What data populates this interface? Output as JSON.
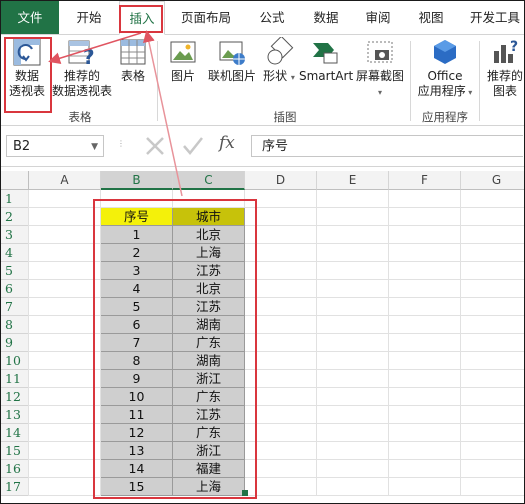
{
  "tabs": [
    "文件",
    "开始",
    "插入",
    "页面布局",
    "公式",
    "数据",
    "审阅",
    "视图",
    "开发工具"
  ],
  "ribbon": {
    "pivot_table": [
      "数据",
      "透视表"
    ],
    "recommended_pivot": [
      "推荐的",
      "数据透视表"
    ],
    "table": "表格",
    "picture": "图片",
    "online_picture": "联机图片",
    "shapes": "形状",
    "smartart": "SmartArt",
    "screenshot": "屏幕截图",
    "office_apps": [
      "Office",
      "应用程序"
    ],
    "recommended_chart": [
      "推荐的",
      "图表"
    ],
    "group_tables": "表格",
    "group_illustrations": "插图",
    "group_apps": "应用程序"
  },
  "formula_bar": {
    "name_box": "B2",
    "fx": "fx",
    "content": "序号"
  },
  "sheet": {
    "columns": [
      "A",
      "B",
      "C",
      "D",
      "E",
      "F",
      "G"
    ],
    "rows": [
      "1",
      "2",
      "3",
      "4",
      "5",
      "6",
      "7",
      "8",
      "9",
      "10",
      "11",
      "12",
      "13",
      "14",
      "15",
      "16",
      "17"
    ],
    "table_header": [
      "序号",
      "城市"
    ],
    "table_rows": [
      [
        "1",
        "北京"
      ],
      [
        "2",
        "上海"
      ],
      [
        "3",
        "江苏"
      ],
      [
        "4",
        "北京"
      ],
      [
        "5",
        "江苏"
      ],
      [
        "6",
        "湖南"
      ],
      [
        "7",
        "广东"
      ],
      [
        "8",
        "湖南"
      ],
      [
        "9",
        "浙江"
      ],
      [
        "10",
        "广东"
      ],
      [
        "11",
        "江苏"
      ],
      [
        "12",
        "广东"
      ],
      [
        "13",
        "浙江"
      ],
      [
        "14",
        "福建"
      ],
      [
        "15",
        "上海"
      ]
    ]
  },
  "colors": {
    "accent": "#217346",
    "highlight": "#d9363e",
    "header_yellow": "#f4f10a"
  }
}
